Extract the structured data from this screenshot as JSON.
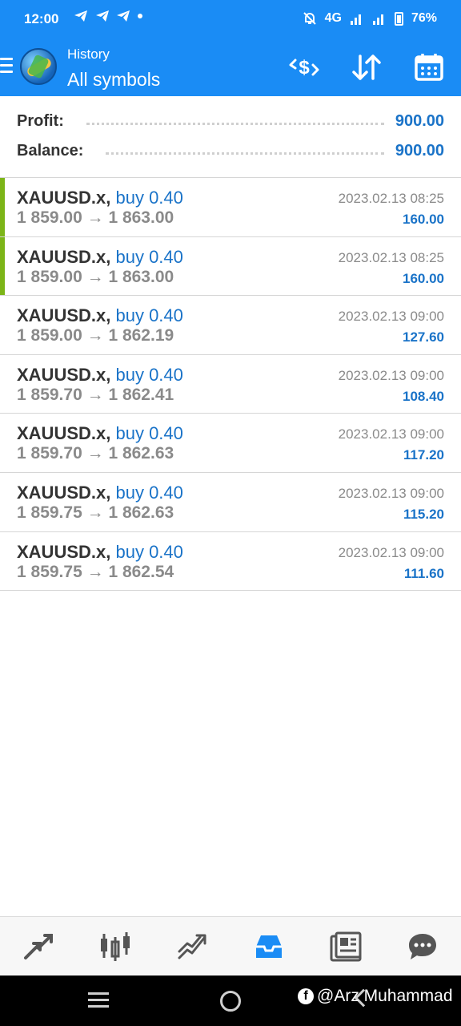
{
  "status_bar": {
    "time": "12:00",
    "notification_icons": [
      "telegram-icon",
      "telegram-icon",
      "telegram-icon",
      "dot-icon"
    ],
    "network": "4G",
    "battery": "76%"
  },
  "header": {
    "subtitle": "History",
    "title": "All symbols",
    "actions": [
      "currency-exchange-icon",
      "sort-icon",
      "calendar-icon"
    ]
  },
  "summary": {
    "profit_label": "Profit:",
    "profit_value": "900.00",
    "balance_label": "Balance:",
    "balance_value": "900.00"
  },
  "deals": [
    {
      "symbol": "XAUUSD.x,",
      "type": "buy 0.40",
      "open_price": "1 859.00",
      "arrow": "→",
      "close_price": "1 863.00",
      "time": "2023.02.13 08:25",
      "profit": "160.00",
      "marked": true
    },
    {
      "symbol": "XAUUSD.x,",
      "type": "buy 0.40",
      "open_price": "1 859.00",
      "arrow": "→",
      "close_price": "1 863.00",
      "time": "2023.02.13 08:25",
      "profit": "160.00",
      "marked": true
    },
    {
      "symbol": "XAUUSD.x,",
      "type": "buy 0.40",
      "open_price": "1 859.00",
      "arrow": "→",
      "close_price": "1 862.19",
      "time": "2023.02.13 09:00",
      "profit": "127.60",
      "marked": false
    },
    {
      "symbol": "XAUUSD.x,",
      "type": "buy 0.40",
      "open_price": "1 859.70",
      "arrow": "→",
      "close_price": "1 862.41",
      "time": "2023.02.13 09:00",
      "profit": "108.40",
      "marked": false
    },
    {
      "symbol": "XAUUSD.x,",
      "type": "buy 0.40",
      "open_price": "1 859.70",
      "arrow": "→",
      "close_price": "1 862.63",
      "time": "2023.02.13 09:00",
      "profit": "117.20",
      "marked": false
    },
    {
      "symbol": "XAUUSD.x,",
      "type": "buy 0.40",
      "open_price": "1 859.75",
      "arrow": "→",
      "close_price": "1 862.63",
      "time": "2023.02.13 09:00",
      "profit": "115.20",
      "marked": false
    },
    {
      "symbol": "XAUUSD.x,",
      "type": "buy 0.40",
      "open_price": "1 859.75",
      "arrow": "→",
      "close_price": "1 862.54",
      "time": "2023.02.13 09:00",
      "profit": "111.60",
      "marked": false
    }
  ],
  "bottom_nav": {
    "items": [
      "quotes-icon",
      "chart-icon",
      "trade-icon",
      "history-icon",
      "news-icon",
      "chat-icon"
    ],
    "active": "history-icon"
  },
  "watermark": "@Arz Muhammad",
  "colors": {
    "header_blue": "#1a8cf5",
    "accent_blue": "#1a73c8",
    "marker_green": "#7cb518",
    "gray_text": "#8a8a8a",
    "nav_icon_gray": "#555555"
  }
}
